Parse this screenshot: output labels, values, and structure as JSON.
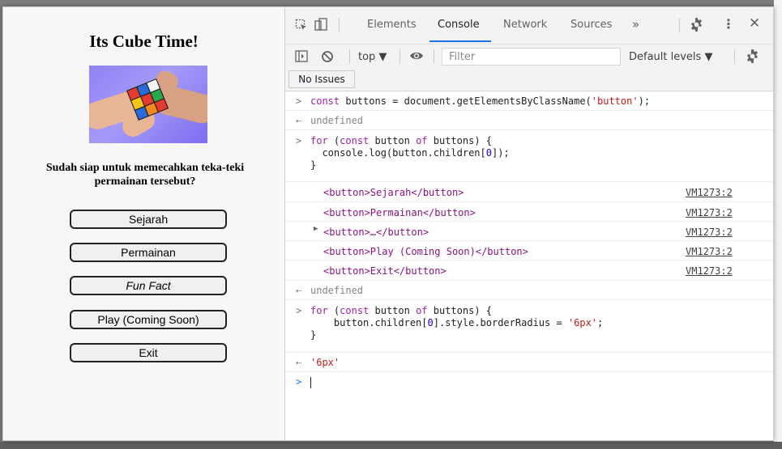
{
  "page": {
    "title": "Its Cube Time!",
    "question": "Sudah siap untuk memecahkan teka-teki permainan tersebut?",
    "buttons": [
      "Sejarah",
      "Permainan",
      "Fun Fact",
      "Play (Coming Soon)",
      "Exit"
    ]
  },
  "devtools": {
    "tabs": [
      "Elements",
      "Console",
      "Network",
      "Sources"
    ],
    "active_tab": "Console",
    "more_tabs": "»",
    "context": "top ▼",
    "filter_placeholder": "Filter",
    "levels": "Default levels ▼",
    "issues": "No Issues",
    "accent_color": "#1a73e8"
  },
  "console": {
    "cmd1": "const buttons = document.getElementsByClassName('button');",
    "res1": "undefined",
    "cmd2_l1": "for (const button of buttons) {",
    "cmd2_l2": "  console.log(button.children[0]);",
    "cmd2_l3": "}",
    "logs": [
      {
        "text": "<button>Sejarah</button>",
        "src": "VM1273:2"
      },
      {
        "text": "<button>Permainan</button>",
        "src": "VM1273:2"
      },
      {
        "text": "<button>…</button>",
        "src": "VM1273:2"
      },
      {
        "text": "<button>Play (Coming Soon)</button>",
        "src": "VM1273:2"
      },
      {
        "text": "<button>Exit</button>",
        "src": "VM1273:2"
      }
    ],
    "res2": "undefined",
    "cmd3_l1": "for (const button of buttons) {",
    "cmd3_l2": "    button.children[0].style.borderRadius = '6px';",
    "cmd3_l3": "}",
    "res3": "'6px'"
  }
}
